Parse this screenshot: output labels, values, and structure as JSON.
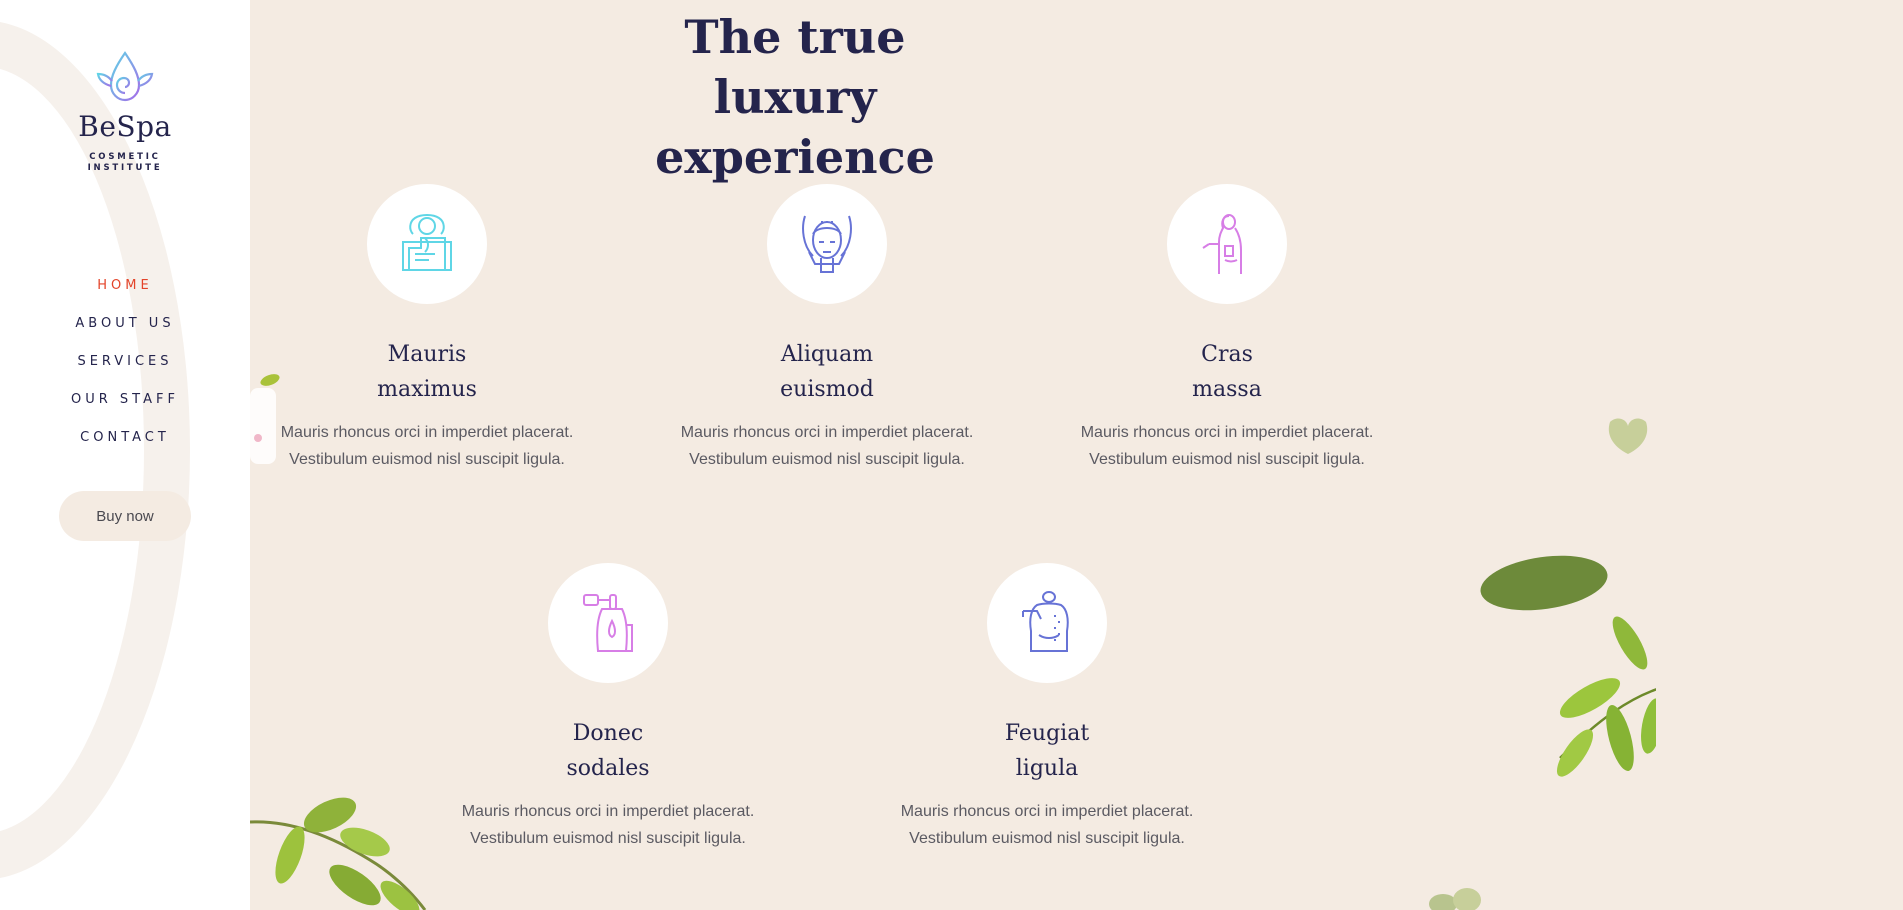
{
  "brand": {
    "name": "BeSpa",
    "subtitle_line1": "COSMETIC",
    "subtitle_line2": "INSTITUTE"
  },
  "nav": {
    "items": [
      {
        "label": "HOME",
        "active": true
      },
      {
        "label": "ABOUT US"
      },
      {
        "label": "SERVICES"
      },
      {
        "label": "OUR STAFF"
      },
      {
        "label": "CONTACT"
      }
    ]
  },
  "buy_button": "Buy now",
  "heading": {
    "line1": "The true luxury",
    "line2": "experience"
  },
  "services": [
    {
      "title_line1": "Mauris",
      "title_line2": "maximus",
      "desc_line1": "Mauris rhoncus orci in imperdiet placerat.",
      "desc_line2": "Vestibulum euismod nisl suscipit ligula.",
      "icon": "massage-back-icon",
      "color": "#5fd6e6"
    },
    {
      "title_line1": "Aliquam",
      "title_line2": "euismod",
      "desc_line1": "Mauris rhoncus orci in imperdiet placerat.",
      "desc_line2": "Vestibulum euismod nisl suscipit ligula.",
      "icon": "face-massage-icon",
      "color": "#6773d6"
    },
    {
      "title_line1": "Cras",
      "title_line2": "massa",
      "desc_line1": "Mauris rhoncus orci in imperdiet placerat.",
      "desc_line2": "Vestibulum euismod nisl suscipit ligula.",
      "icon": "body-treatment-icon",
      "color": "#d77ee6"
    },
    {
      "title_line1": "Donec",
      "title_line2": "sodales",
      "desc_line1": "Mauris rhoncus orci in imperdiet placerat.",
      "desc_line2": "Vestibulum euismod nisl suscipit ligula.",
      "icon": "treatment-device-icon",
      "color": "#d77ee6"
    },
    {
      "title_line1": "Feugiat",
      "title_line2": "ligula",
      "desc_line1": "Mauris rhoncus orci in imperdiet placerat.",
      "desc_line2": "Vestibulum euismod nisl suscipit ligula.",
      "icon": "back-therapy-icon",
      "color": "#6773d6"
    }
  ],
  "colors": {
    "accent": "#e3442a",
    "navy": "#24244c",
    "background": "#f4ebe2"
  }
}
